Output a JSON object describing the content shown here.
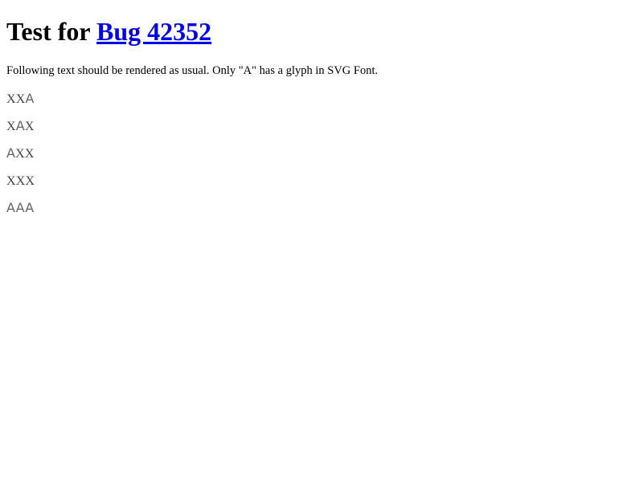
{
  "heading": {
    "prefix": "Test for ",
    "link_text": "Bug 42352"
  },
  "intro": "Following text should be rendered as usual. Only \"A\" has a glyph in SVG Font.",
  "samples": [
    {
      "c1": "X",
      "c2": "X",
      "c3": "A"
    },
    {
      "c1": "X",
      "c2": "A",
      "c3": "X"
    },
    {
      "c1": "A",
      "c2": "X",
      "c3": "X"
    },
    {
      "c1": "X",
      "c2": "X",
      "c3": "X"
    },
    {
      "c1": "A",
      "c2": "A",
      "c3": "A"
    }
  ],
  "colors": {
    "link": "#0000ee",
    "text": "#000000",
    "sample_text": "#555555"
  }
}
